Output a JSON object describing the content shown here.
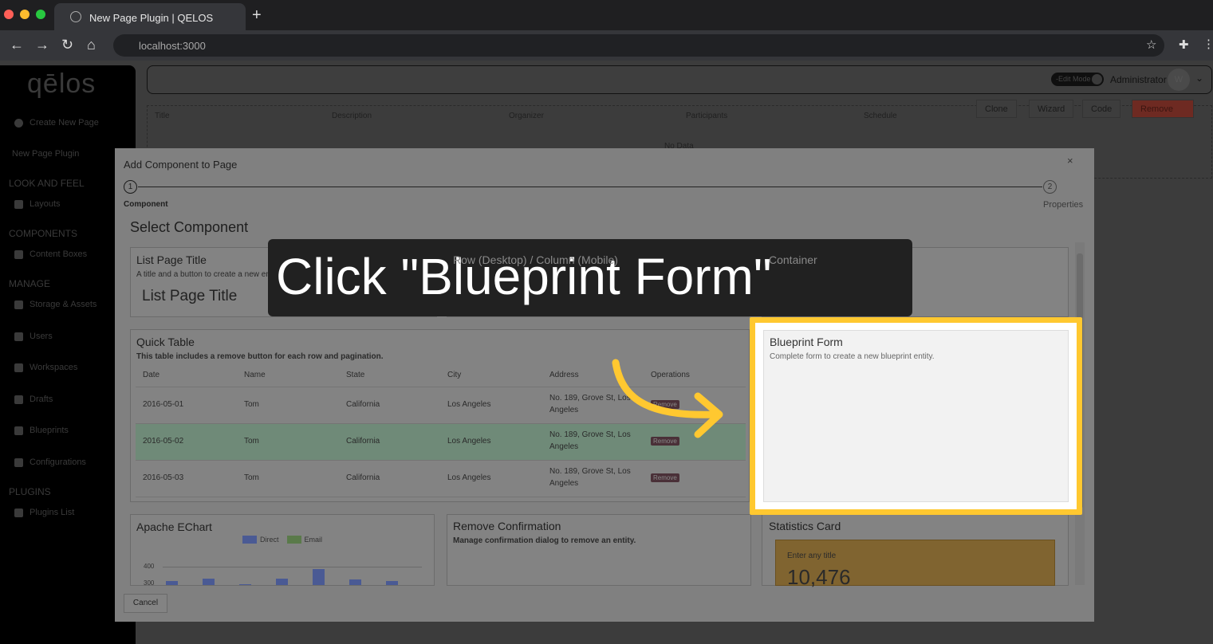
{
  "browser": {
    "tab_title": "New Page Plugin | QELOS",
    "url": "localhost:3000"
  },
  "sidebar": {
    "logo": "qēlos",
    "create": "Create New Page",
    "current": "New Page Plugin",
    "sections": [
      {
        "heading": "LOOK AND FEEL",
        "items": [
          "Layouts"
        ]
      },
      {
        "heading": "COMPONENTS",
        "items": [
          "Content Boxes"
        ]
      },
      {
        "heading": "MANAGE",
        "items": [
          "Storage & Assets",
          "Users",
          "Workspaces",
          "Drafts",
          "Blueprints",
          "Configurations"
        ]
      },
      {
        "heading": "PLUGINS",
        "items": [
          "Plugins List"
        ]
      }
    ]
  },
  "header": {
    "edit_mode": "-Edit Mode-",
    "user": "Administrator",
    "avatar": "W"
  },
  "toolbar": {
    "clone": "Clone",
    "wizard": "Wizard",
    "code": "Code",
    "remove": "Remove"
  },
  "bg_table": {
    "columns": [
      "Title",
      "Description",
      "Organizer",
      "Participants",
      "Schedule"
    ],
    "empty": "No Data"
  },
  "modal": {
    "title": "Add Component to Page",
    "close": "×",
    "steps": [
      {
        "num": "1",
        "label": "Component"
      },
      {
        "num": "2",
        "label": "Properties"
      }
    ],
    "heading": "Select Component",
    "cancel": "Cancel",
    "cards": {
      "list_title": {
        "title": "List Page Title",
        "desc": "A title and a button to create a new entity.",
        "preview": "List Page Title"
      },
      "row_col": {
        "title": "Row (Desktop) / Column (Mobile)"
      },
      "container": {
        "title": "Container"
      },
      "quick_table": {
        "title": "Quick Table",
        "desc": "This table includes a remove button for each row and pagination.",
        "columns": [
          "Date",
          "Name",
          "State",
          "City",
          "Address",
          "Operations"
        ],
        "rows": [
          [
            "2016-05-01",
            "Tom",
            "California",
            "Los Angeles",
            "No. 189, Grove St, Los Angeles",
            "Remove"
          ],
          [
            "2016-05-02",
            "Tom",
            "California",
            "Los Angeles",
            "No. 189, Grove St, Los Angeles",
            "Remove"
          ],
          [
            "2016-05-03",
            "Tom",
            "California",
            "Los Angeles",
            "No. 189, Grove St, Los Angeles",
            "Remove"
          ]
        ]
      },
      "blueprint_form": {
        "title": "Blueprint Form",
        "desc": "Complete form to create a new blueprint entity."
      },
      "echart": {
        "title": "Apache EChart",
        "legend": [
          "Direct",
          "Email"
        ],
        "ticks": [
          "400",
          "300"
        ]
      },
      "remove_confirm": {
        "title": "Remove Confirmation",
        "desc": "Manage confirmation dialog to remove an entity."
      },
      "stats": {
        "title": "Statistics Card",
        "label": "Enter any title",
        "value": "10,476"
      }
    }
  },
  "callout": {
    "text": "Click \"Blueprint Form\"",
    "highlight_color": "#ffc830"
  }
}
